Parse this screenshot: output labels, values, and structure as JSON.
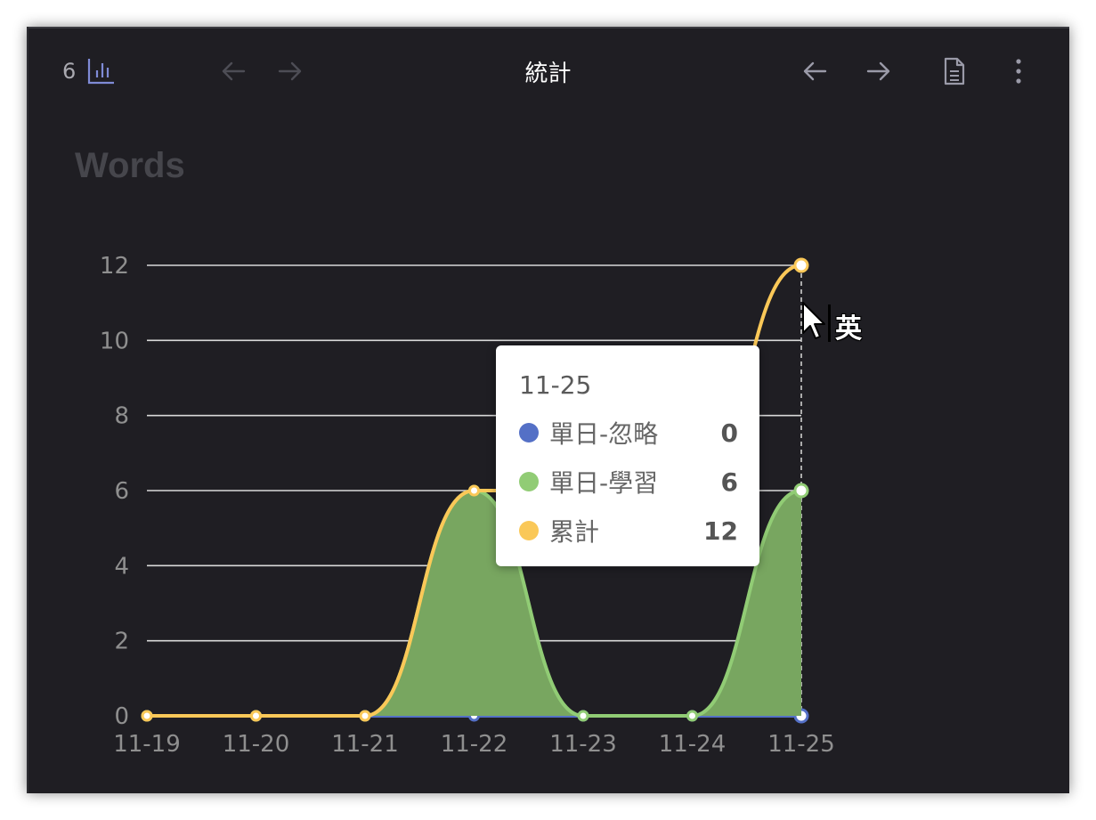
{
  "header": {
    "count": "6",
    "count_icon": "bar-chart-icon",
    "title": "統計",
    "icons": [
      "arrow-left-icon",
      "arrow-right-icon",
      "arrow-left-icon",
      "arrow-right-icon",
      "file-text-icon",
      "more-vertical-icon"
    ]
  },
  "chart_title": "Words",
  "chart_data": {
    "type": "line",
    "title": "Words",
    "categories": [
      "11-19",
      "11-20",
      "11-21",
      "11-22",
      "11-23",
      "11-24",
      "11-25"
    ],
    "ylim": [
      0,
      12
    ],
    "yticks": [
      0,
      2,
      4,
      6,
      8,
      10,
      12
    ],
    "grid": true,
    "series": [
      {
        "name": "單日-忽略",
        "color": "#5470c6",
        "values": [
          0,
          0,
          0,
          0,
          0,
          0,
          0
        ],
        "area": false
      },
      {
        "name": "單日-學習",
        "color": "#91cc75",
        "values": [
          0,
          0,
          0,
          6,
          0,
          0,
          6
        ],
        "area": true
      },
      {
        "name": "累計",
        "color": "#fac858",
        "values": [
          0,
          0,
          0,
          6,
          6,
          6,
          12
        ],
        "area": false
      }
    ],
    "smooth": true
  },
  "tooltip": {
    "title": "11-25",
    "rows": [
      {
        "name": "單日-忽略",
        "value": "0",
        "color": "#5470c6"
      },
      {
        "name": "單日-學習",
        "value": "6",
        "color": "#91cc75"
      },
      {
        "name": "累計",
        "value": "12",
        "color": "#fac858"
      }
    ]
  },
  "ime_indicator": "英",
  "colors": {
    "background": "#1f1e23",
    "grid": "#d9d9d9",
    "axis_text": "#8f8f8f",
    "area_fill": "#78a660"
  }
}
